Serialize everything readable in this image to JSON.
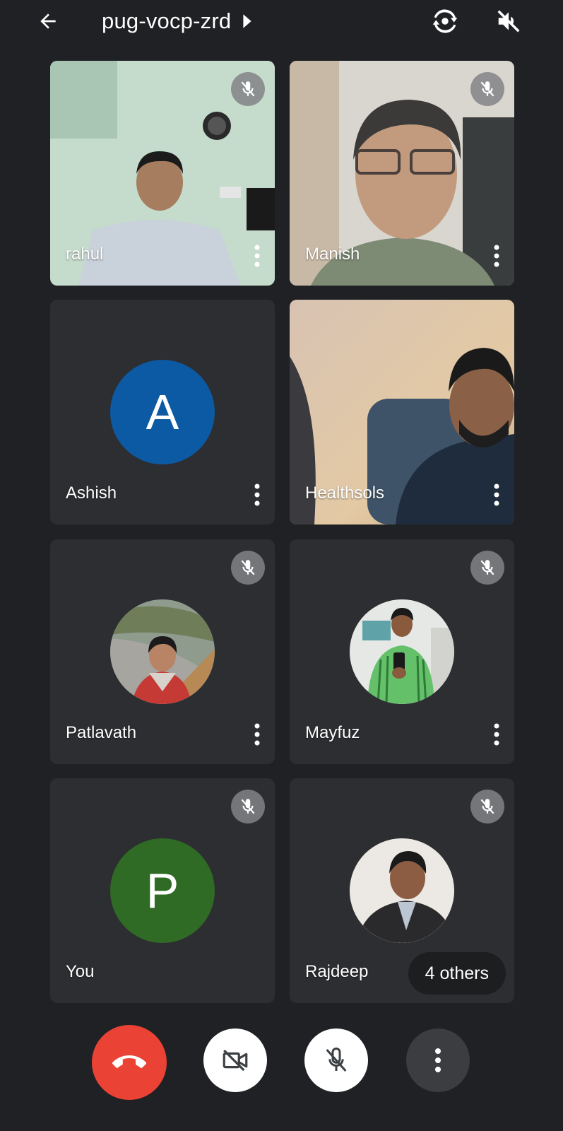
{
  "meeting": {
    "code": "pug-vocp-zrd"
  },
  "toolbar": {
    "back_icon": "arrow-left-icon",
    "switch_camera_icon": "switch-camera-icon",
    "audio_icon": "speaker-off-icon"
  },
  "participants": [
    {
      "name": "rahul",
      "type": "video",
      "muted": true
    },
    {
      "name": "Manish",
      "type": "video",
      "muted": true
    },
    {
      "name": "Ashish",
      "type": "initial",
      "initial": "A",
      "color": "#0b5aa3",
      "muted": false
    },
    {
      "name": "Healthsols",
      "type": "video",
      "muted": false
    },
    {
      "name": "Patlavath",
      "type": "photo",
      "muted": true
    },
    {
      "name": "Mayfuz",
      "type": "photo",
      "muted": true
    },
    {
      "name": "You",
      "type": "initial",
      "initial": "P",
      "color": "#2f6b25",
      "muted": true
    },
    {
      "name": "Rajdeep",
      "type": "photo",
      "muted": true
    }
  ],
  "others_label": "4 others",
  "controls": {
    "end_call_color": "#ea4335",
    "end_call_icon": "end-call-icon",
    "camera_icon": "camera-off-icon",
    "mic_icon": "mic-off-icon",
    "more_icon": "more-vert-icon"
  }
}
